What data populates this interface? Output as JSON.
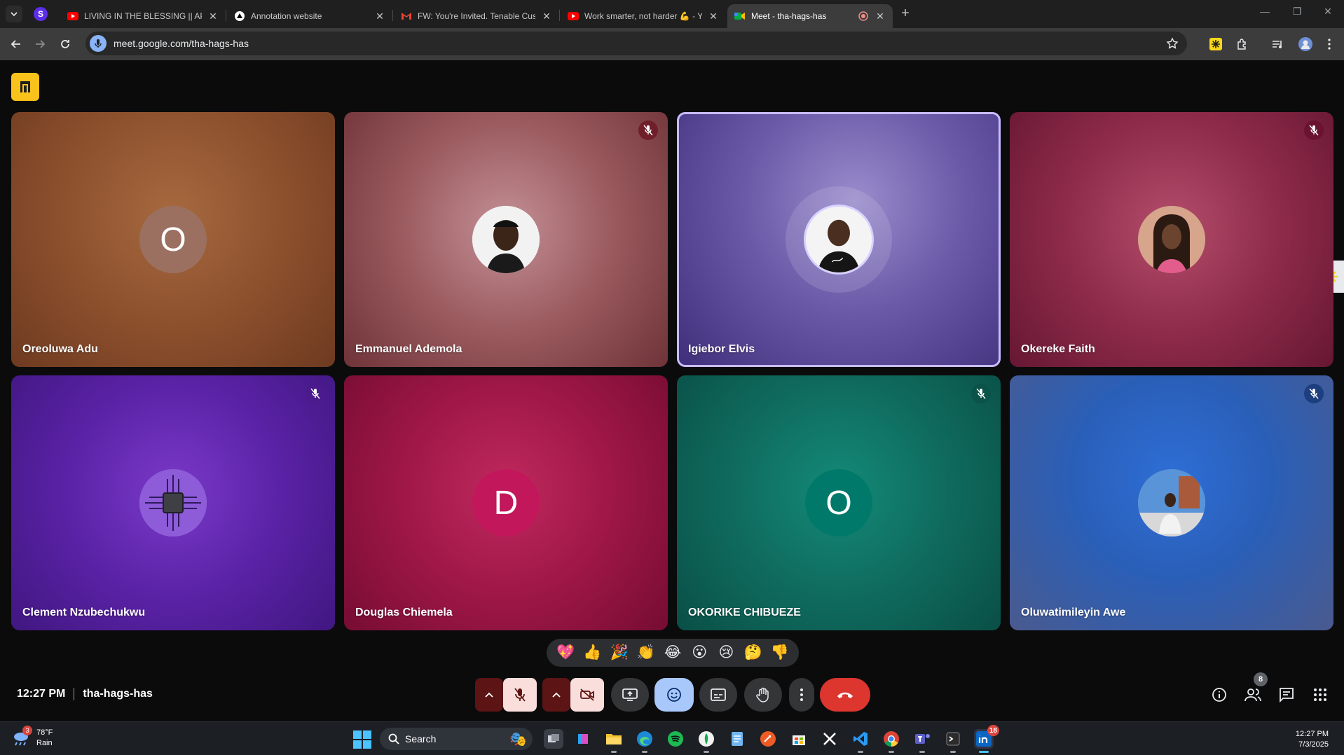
{
  "browser": {
    "tabs": [
      {
        "title": "LIVING IN THE BLESSING || APOSTLE",
        "favicon": "youtube-icon",
        "active": false
      },
      {
        "title": "Annotation website",
        "favicon": "vercel-icon",
        "active": false
      },
      {
        "title": "FW: You're Invited. Tenable Customer",
        "favicon": "gmail-icon",
        "active": false
      },
      {
        "title": "Work smarter, not harder 💪 - YouTube",
        "favicon": "youtube-icon",
        "active": false
      },
      {
        "title": "Meet - tha-hags-has",
        "favicon": "google-meet-icon",
        "active": true
      }
    ],
    "pinned_tab_letter": "S",
    "new_tab": "+",
    "close": "✕",
    "address": "meet.google.com/tha-hags-has"
  },
  "meet": {
    "code": "tha-hags-has",
    "time": "12:27 PM",
    "participants_count": "8",
    "participants": [
      {
        "name": "Oreoluwa Adu",
        "initial": "O",
        "avatar": "letter",
        "muted": false,
        "bg": "#8a4e2c",
        "circle": "#9b7060"
      },
      {
        "name": "Emmanuel Ademola",
        "initial": "",
        "avatar": "photo",
        "muted": true,
        "bg": "#9a5a5e",
        "circle": "#f2f2f2"
      },
      {
        "name": "Igiebor Elvis",
        "initial": "",
        "avatar": "photo",
        "muted": false,
        "speaking": true,
        "bg": "#6a5aa8",
        "circle": "#f2f2f2"
      },
      {
        "name": "Okereke Faith",
        "initial": "",
        "avatar": "photo",
        "muted": true,
        "bg": "#8e2b4a",
        "circle": "#c8907a"
      },
      {
        "name": "Clement Nzubechukwu",
        "initial": "",
        "avatar": "circuit",
        "muted": true,
        "bg": "#5a22a6",
        "circle": "#9b6ee0"
      },
      {
        "name": "Douglas Chiemela",
        "initial": "D",
        "avatar": "letter",
        "muted": false,
        "bg": "#9e1746",
        "circle": "#c2185b"
      },
      {
        "name": "OKORIKE CHIBUEZE",
        "initial": "O",
        "avatar": "letter",
        "muted": true,
        "bg": "#0f6b5e",
        "circle": "#00796b"
      },
      {
        "name": "Oluwatimileyin Awe",
        "initial": "",
        "avatar": "photo",
        "muted": true,
        "bg": "#2a5fb8",
        "circle": "#6fa0d8"
      }
    ],
    "reactions": [
      "💖",
      "👍",
      "🎉",
      "👏",
      "😂",
      "😮",
      "😢",
      "🤔",
      "👎"
    ]
  },
  "taskbar": {
    "weather_temp": "78°F",
    "weather_desc": "Rain",
    "weather_badge": "3",
    "search_placeholder": "Search",
    "linkedin_badge": "18",
    "clock_time": "12:27 PM",
    "clock_date": "7/3/2025"
  },
  "colors": {
    "accent_blue": "#a8c7fa",
    "end_call": "#dc362e",
    "speaking_border": "#c9bcff"
  }
}
